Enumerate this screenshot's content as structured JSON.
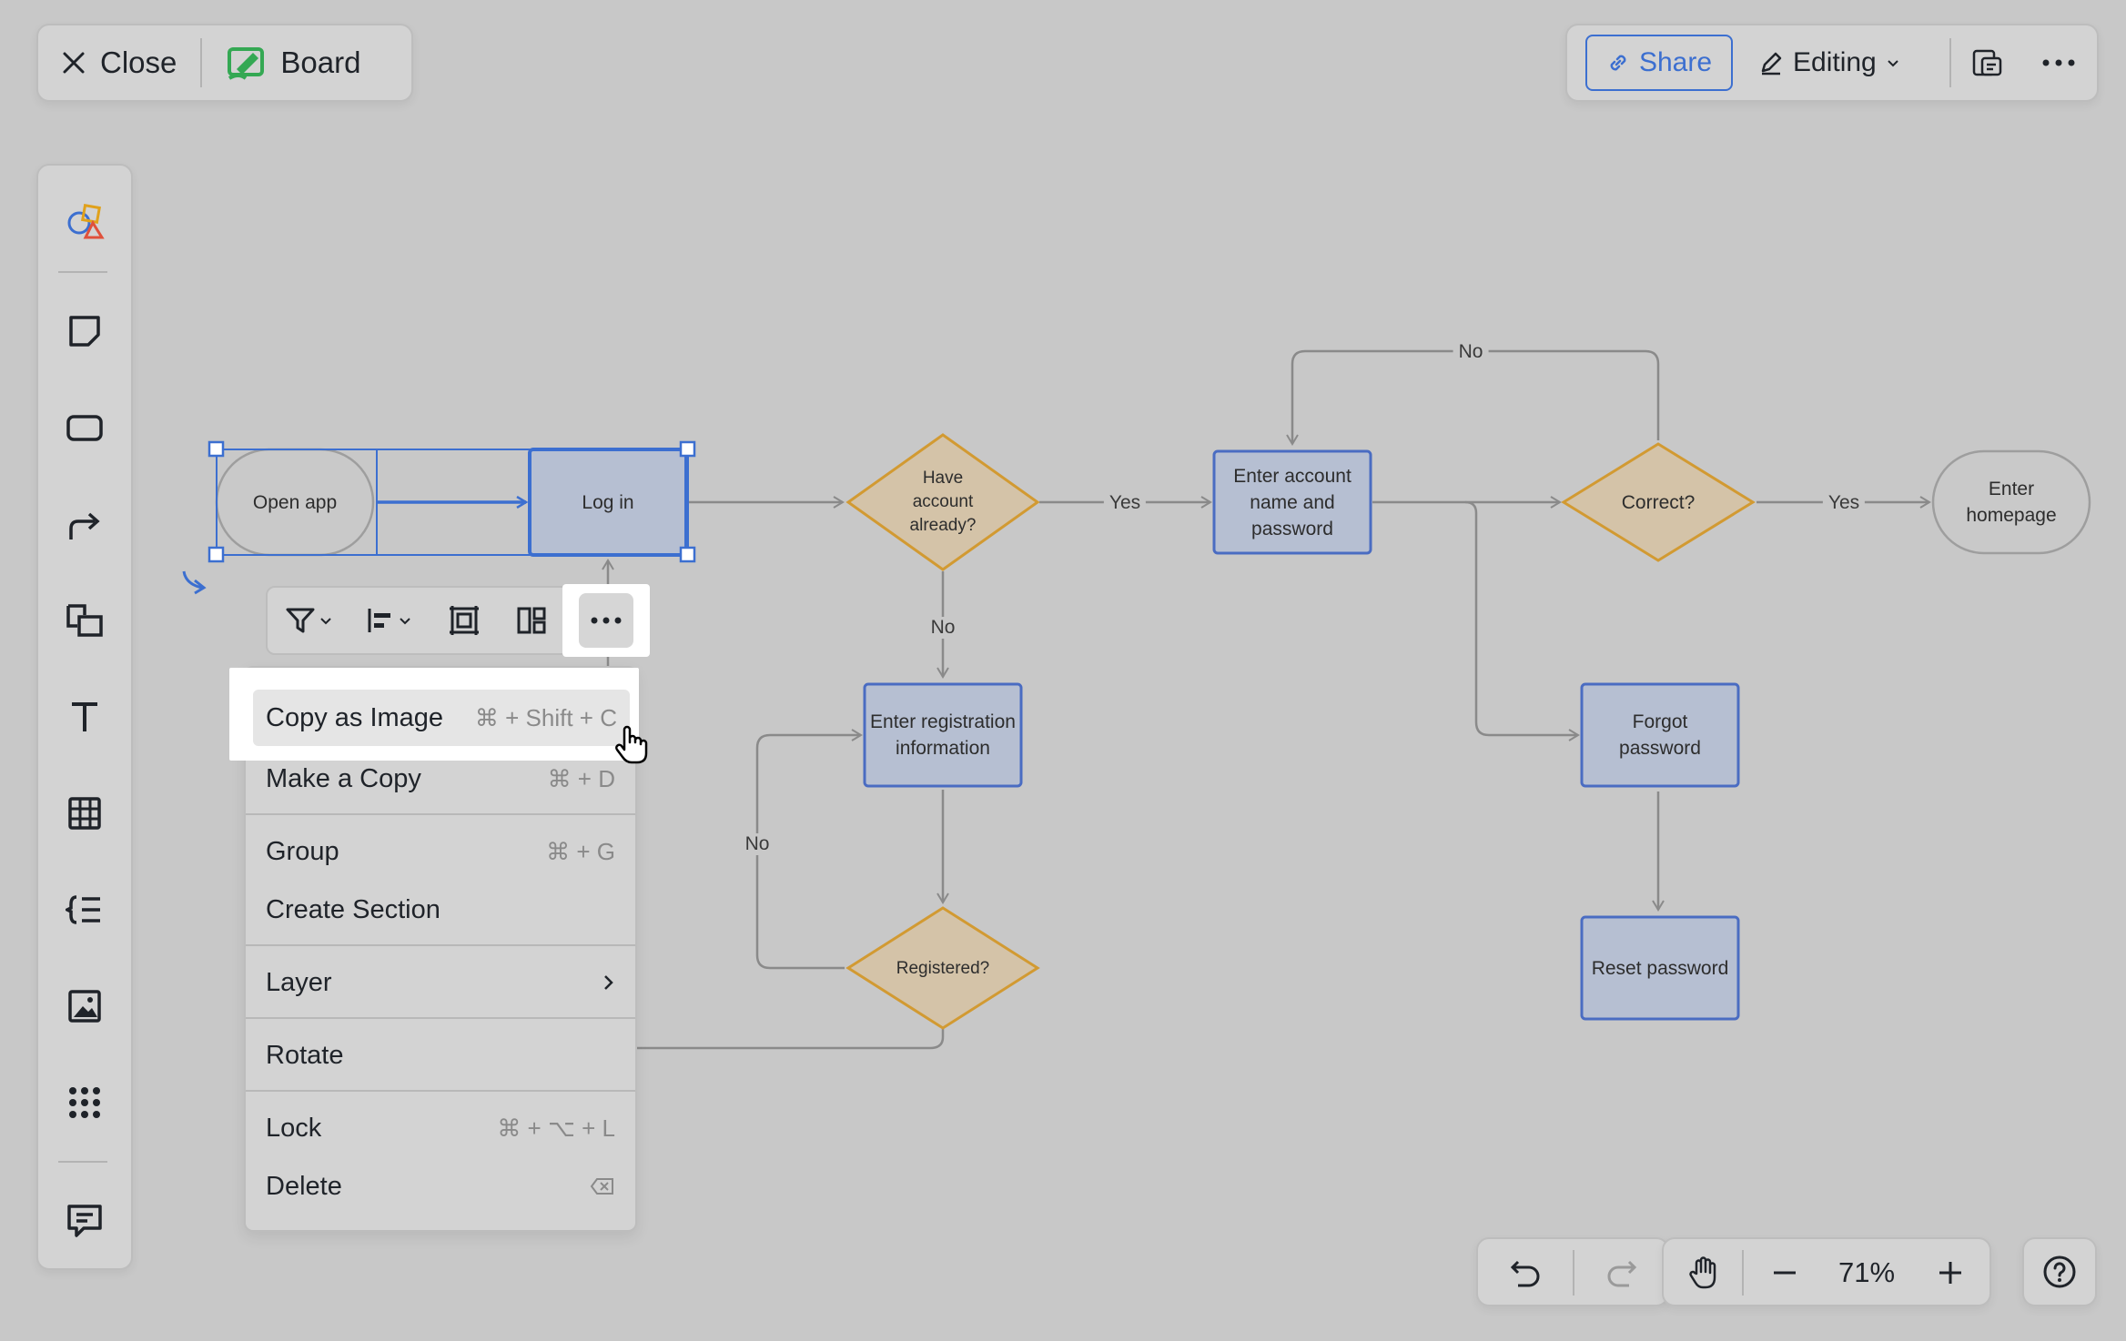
{
  "header": {
    "close_label": "Close",
    "doc_label": "Board"
  },
  "top_right": {
    "share_label": "Share",
    "editing_label": "Editing"
  },
  "left_toolbar": {
    "icons": [
      "shapes-icon",
      "sticky-note-icon",
      "rectangle-icon",
      "connector-icon",
      "section-icon",
      "text-icon",
      "table-icon",
      "mindmap-icon",
      "image-icon",
      "more-apps-icon",
      "comment-icon"
    ]
  },
  "flowchart": {
    "nodes": {
      "open_app": "Open app",
      "log_in": "Log in",
      "have_account": "Have account already?",
      "enter_account": "Enter account name and password",
      "correct": "Correct?",
      "enter_homepage": "Enter homepage",
      "enter_registration": "Enter registration information",
      "registered": "Registered?",
      "forgot_password": "Forgot password",
      "reset_password": "Reset password"
    },
    "edge_labels": {
      "yes_1": "Yes",
      "yes_2": "Yes",
      "no_down": "No",
      "no_top": "No",
      "no_left": "No"
    }
  },
  "context_menu": {
    "items": [
      {
        "label": "Copy as Image",
        "shortcut": "⌘ + Shift + C"
      },
      {
        "label": "Make a Copy",
        "shortcut": "⌘ + D"
      },
      {
        "label": "Group",
        "shortcut": "⌘ + G"
      },
      {
        "label": "Create Section",
        "shortcut": ""
      },
      {
        "label": "Layer",
        "shortcut": ""
      },
      {
        "label": "Rotate",
        "shortcut": ""
      },
      {
        "label": "Lock",
        "shortcut": "⌘ + ⌥ + L"
      },
      {
        "label": "Delete",
        "shortcut": ""
      }
    ]
  },
  "bottom": {
    "zoom": "71%"
  },
  "colors": {
    "accent": "#3c6fd0",
    "process_fill": "#b6bfd2",
    "process_border": "#4a6cc2",
    "decision_fill": "#d4c3a8",
    "decision_border": "#d29a32",
    "terminal_fill": "#c9c9c9"
  }
}
